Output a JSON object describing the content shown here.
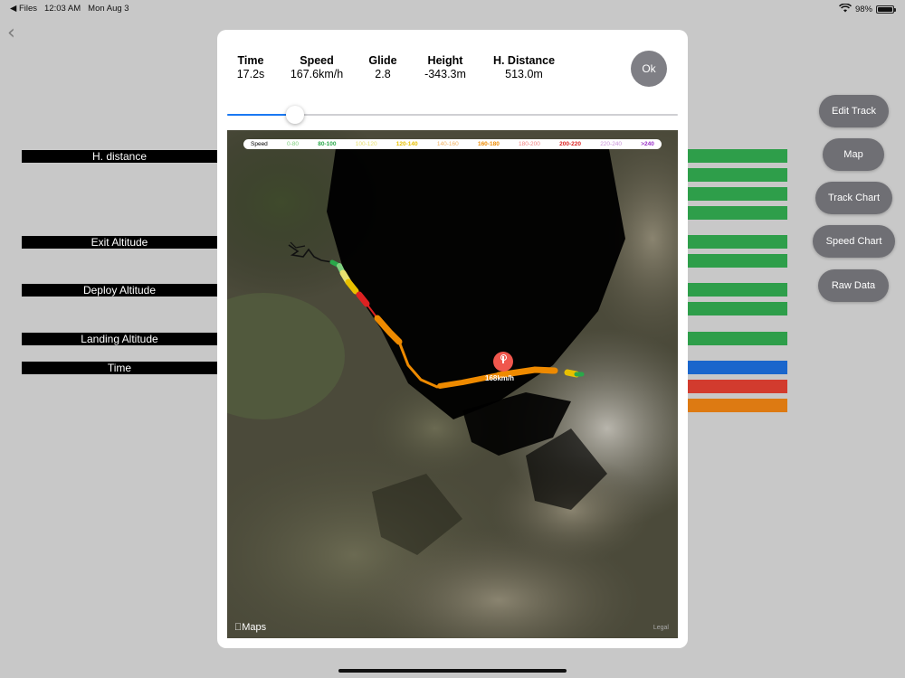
{
  "status_bar": {
    "back_app": "◀ Files",
    "time": "12:03 AM",
    "date": "Mon Aug 3",
    "battery": "98%",
    "battery_level": 0.98
  },
  "nav": {
    "back_icon": "chevron-left-icon"
  },
  "background_rows": [
    {
      "label": "H. distance"
    },
    {
      "label": "Exit Altitude"
    },
    {
      "label": "Deploy Altitude"
    },
    {
      "label": "Landing Altitude"
    },
    {
      "label": "Time"
    }
  ],
  "background_bar_colors": [
    "#2e9e4a",
    "#2e9e4a",
    "#2e9e4a",
    "#2e9e4a",
    "#2e9e4a",
    "#2e9e4a",
    "#2e9e4a",
    "#2e9e4a",
    "#2e9e4a",
    "#1a66cc",
    "#d23b2e",
    "#dd7a12"
  ],
  "side_buttons": [
    {
      "label": "Edit Track"
    },
    {
      "label": "Map"
    },
    {
      "label": "Track Chart"
    },
    {
      "label": "Speed Chart"
    },
    {
      "label": "Raw Data"
    }
  ],
  "modal": {
    "stats": [
      {
        "label": "Time",
        "value": "17.2s"
      },
      {
        "label": "Speed",
        "value": "167.6km/h"
      },
      {
        "label": "Glide",
        "value": "2.8"
      },
      {
        "label": "Height",
        "value": "-343.3m"
      },
      {
        "label": "H. Distance",
        "value": "513.0m"
      }
    ],
    "ok_label": "Ok",
    "slider_fraction": 0.15,
    "legend": [
      {
        "text": "Speed",
        "color": "#000000"
      },
      {
        "text": "0-80",
        "color": "#7fd07f"
      },
      {
        "text": "80-100",
        "color": "#2aa84a"
      },
      {
        "text": "100-120",
        "color": "#e8e070"
      },
      {
        "text": "120-140",
        "color": "#e8c000"
      },
      {
        "text": "140-160",
        "color": "#f0b060"
      },
      {
        "text": "160-180",
        "color": "#ee8a00"
      },
      {
        "text": "180-200",
        "color": "#f08080"
      },
      {
        "text": "200-220",
        "color": "#dd2222"
      },
      {
        "text": "220-240",
        "color": "#c890d8"
      },
      {
        "text": ">240",
        "color": "#9a30c8"
      }
    ],
    "map_pin_label": "168km/h",
    "maps_credit": "Maps",
    "legal": "Legal"
  },
  "colors": {
    "accent": "#1a79f3",
    "button_gray": "#6f6f74",
    "track_orange": "#ee8a00",
    "pin_red": "#f0574d"
  }
}
